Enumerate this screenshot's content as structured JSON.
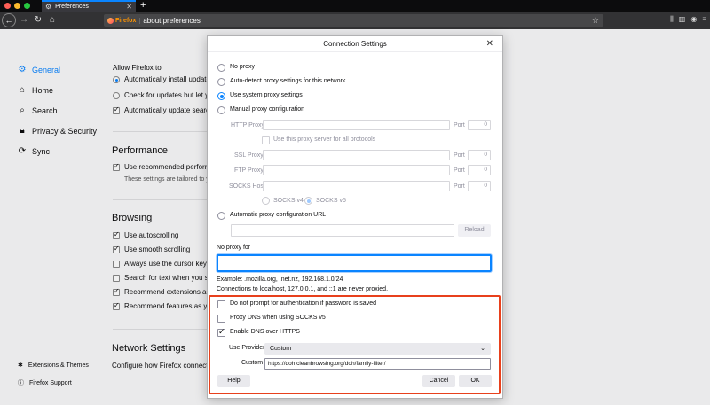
{
  "browser": {
    "tab_title": "Preferences",
    "tab_icon": "gear-icon",
    "url_badge": "Firefox",
    "url": "about:preferences"
  },
  "sidebar": {
    "items": [
      {
        "label": "General",
        "icon": "gear-icon",
        "active": true
      },
      {
        "label": "Home",
        "icon": "home-icon"
      },
      {
        "label": "Search",
        "icon": "search-icon"
      },
      {
        "label": "Privacy & Security",
        "icon": "lock-icon"
      },
      {
        "label": "Sync",
        "icon": "sync-icon"
      }
    ],
    "footer": [
      {
        "label": "Extensions & Themes",
        "icon": "puzzle-icon"
      },
      {
        "label": "Firefox Support",
        "icon": "help-icon"
      }
    ]
  },
  "prefs": {
    "allow_label": "Allow Firefox to",
    "updates": [
      "Automatically install updates",
      "Check for updates but let yo",
      "Automatically update search"
    ],
    "performance_heading": "Performance",
    "use_recommended": "Use recommended performan",
    "settings_tailored": "These settings are tailored to y",
    "browsing_heading": "Browsing",
    "browsing": [
      {
        "label": "Use autoscrolling",
        "checked": true
      },
      {
        "label": "Use smooth scrolling",
        "checked": true
      },
      {
        "label": "Always use the cursor keys t",
        "checked": false
      },
      {
        "label": "Search for text when you st",
        "checked": false
      },
      {
        "label": "Recommend extensions as y",
        "checked": true
      },
      {
        "label": "Recommend features as you",
        "checked": true
      }
    ],
    "network_heading": "Network Settings",
    "network_sub": "Configure how Firefox connects"
  },
  "dialog": {
    "title": "Connection Settings",
    "proxy_options": {
      "no_proxy": "No proxy",
      "auto_detect": "Auto-detect proxy settings for this network",
      "system_proxy": "Use system proxy settings",
      "manual": "Manual proxy configuration",
      "selected": "system_proxy"
    },
    "http_proxy_label": "HTTP Proxy",
    "port_label": "Port",
    "port_value": "0",
    "use_for_all": "Use this proxy server for all protocols",
    "ssl_proxy_label": "SSL Proxy",
    "ftp_proxy_label": "FTP Proxy",
    "socks_host_label": "SOCKS Host",
    "socks_v4": "SOCKS v4",
    "socks_v5": "SOCKS v5",
    "auto_config_url": "Automatic proxy configuration URL",
    "reload_label": "Reload",
    "no_proxy_for": "No proxy for",
    "example": "Example: .mozilla.org, .net.nz, 192.168.1.0/24",
    "localhost_note": "Connections to localhost, 127.0.0.1, and ::1 are never proxied.",
    "no_auth_prompt": "Do not prompt for authentication if password is saved",
    "proxy_dns": "Proxy DNS when using SOCKS v5",
    "enable_doh": "Enable DNS over HTTPS",
    "use_provider_label": "Use Provider",
    "provider_value": "Custom",
    "custom_label": "Custom",
    "custom_value": "https://doh.cleanbrowsing.org/doh/family-filter/",
    "help_button": "Help",
    "cancel_button": "Cancel",
    "ok_button": "OK"
  },
  "colors": {
    "accent": "#0a84ff",
    "highlight": "#e8401c"
  }
}
